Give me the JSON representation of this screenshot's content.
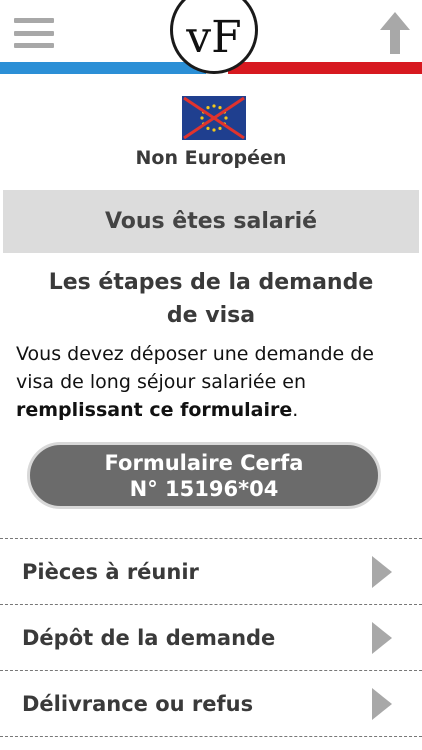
{
  "header": {
    "logo_text": "vF",
    "menu_icon": "hamburger-menu-icon",
    "up_icon": "arrow-up-icon",
    "colors": {
      "blue": "#2b8fd6",
      "white": "#ffffff",
      "red": "#d71920"
    }
  },
  "origin": {
    "flag_icon": "eu-flag-crossed-icon",
    "label": "Non Européen"
  },
  "status": {
    "label": "Vous êtes salarié"
  },
  "section": {
    "title": "Les étapes de la demande de visa",
    "intro_text": "Vous devez déposer une demande de visa de long séjour salariée en ",
    "intro_bold": "remplissant ce formulaire",
    "intro_end": "."
  },
  "cerfa_button": {
    "line1": "Formulaire Cerfa",
    "line2": "N° 15196*04"
  },
  "steps": [
    {
      "label": "Pièces à réunir"
    },
    {
      "label": "Dépôt de la demande"
    },
    {
      "label": "Délivrance ou refus"
    }
  ]
}
